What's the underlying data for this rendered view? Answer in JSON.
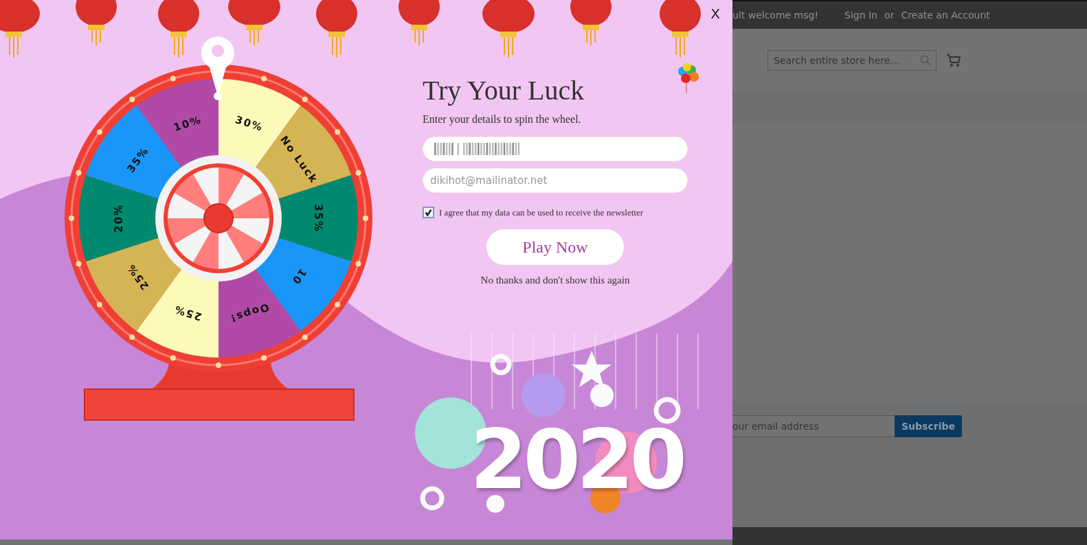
{
  "popup": {
    "close": "X",
    "title": "Try Your Luck",
    "subtitle": "Enter your details to spin the wheel.",
    "email_value": "dikihot@mailinator.net",
    "agree": {
      "label": "I agree that my data can be used to receive the newsletter",
      "checked": true
    },
    "play_button": "Play Now",
    "dismiss_link": "No thanks and don't show this again",
    "year": "2020",
    "wheel": [
      {
        "label": "30%",
        "color": "#fdfab9"
      },
      {
        "label": "No Luck",
        "color": "#d4b454"
      },
      {
        "label": "35%",
        "color": "#01896f"
      },
      {
        "label": "10",
        "color": "#1a96f9"
      },
      {
        "label": "Oops!",
        "color": "#b14aa6"
      },
      {
        "label": "25%",
        "color": "#fdfab9"
      },
      {
        "label": "25%",
        "color": "#d4b454"
      },
      {
        "label": "20%",
        "color": "#01896f"
      },
      {
        "label": "35%",
        "color": "#1a96f9"
      },
      {
        "label": "10%",
        "color": "#b14aa6"
      }
    ]
  },
  "header": {
    "welcome": "ult welcome msg!",
    "sign_in": "Sign In",
    "or": "or",
    "create_account": "Create an Account"
  },
  "search": {
    "placeholder": "Search entire store here..."
  },
  "newsletter": {
    "placeholder": "our email address",
    "button": "Subscribe"
  }
}
